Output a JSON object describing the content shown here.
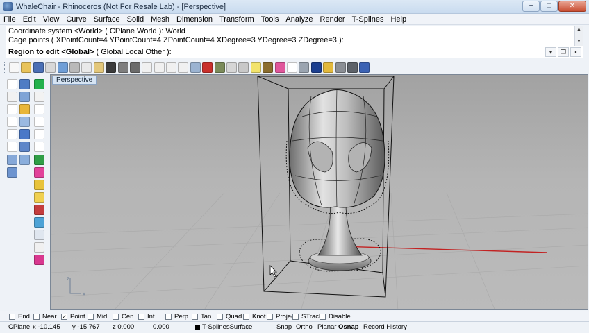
{
  "window": {
    "title": "WhaleChair - Rhinoceros (Not For Resale Lab) - [Perspective]",
    "controls": [
      "−",
      "□",
      "✕"
    ]
  },
  "menu": [
    "File",
    "Edit",
    "View",
    "Curve",
    "Surface",
    "Solid",
    "Mesh",
    "Dimension",
    "Transform",
    "Tools",
    "Analyze",
    "Render",
    "T-Splines",
    "Help"
  ],
  "command": {
    "history": [
      "Coordinate system <World> ( CPlane  World ): World",
      "Cage points ( XPointCount=4  YPointCount=4  ZPointCount=4  XDegree=3  YDegree=3  ZDegree=3 ):"
    ],
    "prompt_bold": "Region to edit <Global>",
    "prompt_rest": " ( Global  Local  Other ):",
    "input_value": ""
  },
  "toolbar": {
    "icons": [
      "new-file-icon",
      "open-folder-icon",
      "save-icon",
      "print-icon",
      "import-icon",
      "cut-icon",
      "copy-icon",
      "paste-icon",
      "undo-icon",
      "pan-icon",
      "rotate-view-icon",
      "zoom-icon",
      "zoom-window-icon",
      "zoom-extents-icon",
      "zoom-selected-icon",
      "four-viewports-icon",
      "car-icon",
      "tank-icon",
      "grid-snap-icon",
      "options-icon",
      "light-bulb-icon",
      "lock-icon",
      "color-wheel-icon",
      "wireframe-sphere-icon",
      "shaded-sphere-icon",
      "render-sphere-icon",
      "wand-icon",
      "gear-icon",
      "gears-icon",
      "help-icon"
    ],
    "colors": [
      "#f7f7f7",
      "#e8c35a",
      "#4a6fb5",
      "#d8d8d8",
      "#6f9ed6",
      "#b9b9b9",
      "#e9e9e9",
      "#e3c77a",
      "#3b3b3b",
      "#7e7e7e",
      "#6b6b6b",
      "#f0f0f0",
      "#f0f0f0",
      "#f0f0f0",
      "#f0f0f0",
      "#9bb3d1",
      "#c9302c",
      "#7b8b5a",
      "#d6d6d6",
      "#c8c8c8",
      "#f2e36b",
      "#8a6d2e",
      "#e0569b",
      "#ffffff",
      "#9aa4b0",
      "#1c3f8f",
      "#e3b93c",
      "#8b8f95",
      "#5d6269",
      "#3b62b4"
    ]
  },
  "left_toolbar": {
    "col1": [
      "select-arrow-icon",
      "point-icon",
      "circle-icon",
      "arc-icon",
      "rectangle-icon",
      "surface-icon",
      "box-icon",
      "extrude-icon",
      "loft-icon",
      "mesh-icon",
      "fillet-icon",
      "trim-icon",
      "text-icon",
      "dimension-icon",
      "block-icon"
    ],
    "col1_colors": [
      "#ffffff",
      "#f2f2f2",
      "#ffffff",
      "#ffffff",
      "#ffffff",
      "#ffffff",
      "#86a8d8",
      "#6d94cf",
      "#4f7cc4",
      "#7fa4d6",
      "#e8b63a",
      "#9ab9e2",
      "#4a78c8",
      "#5e86c9",
      "#8aaedc"
    ],
    "col2": [
      "green-circle-icon",
      "point-cloud-icon",
      "polygon-icon",
      "polyline-icon",
      "ellipse-icon",
      "helix-icon",
      "sphere-icon",
      "cylinder-icon",
      "cone-icon",
      "torus-icon",
      "boolean-icon",
      "split-icon",
      "explode-icon",
      "history-icon",
      "analyze-icon"
    ],
    "col2_colors": [
      "#22b14c",
      "#f2f2f2",
      "#ffffff",
      "#ffffff",
      "#ffffff",
      "#ffffff",
      "#2f9e46",
      "#e2429a",
      "#e8c33a",
      "#f0d050",
      "#c43d3d",
      "#4ea3d6",
      "#dfe6ef",
      "#f0f0f0",
      "#d9388f"
    ]
  },
  "viewport": {
    "name": "Perspective",
    "axis_labels": {
      "x": "x",
      "z": "z"
    },
    "colors": {
      "background": "#b0b0b0",
      "xaxis": "#c22222",
      "yaxis": "#22a022",
      "cage": "#111111"
    }
  },
  "osnap": [
    {
      "label": "End",
      "checked": false
    },
    {
      "label": "Near",
      "checked": false
    },
    {
      "label": "Point",
      "checked": true
    },
    {
      "label": "Mid",
      "checked": false
    },
    {
      "label": "Cen",
      "checked": false
    },
    {
      "label": "Int",
      "checked": false
    },
    {
      "label": "Perp",
      "checked": false
    },
    {
      "label": "Tan",
      "checked": false
    },
    {
      "label": "Quad",
      "checked": false
    },
    {
      "label": "Knot",
      "checked": false
    },
    {
      "label": "Project",
      "checked": false
    },
    {
      "label": "STrack",
      "checked": false
    },
    {
      "label": "Disable",
      "checked": false
    }
  ],
  "status": {
    "cplane": "CPlane",
    "x": "x -10.145",
    "y": "y -15.767",
    "z": "z 0.000",
    "extra": "0.000",
    "layer": "T-SplinesSurface",
    "snap": "Snap",
    "ortho": "Ortho",
    "planar": "Planar",
    "osnap": "Osnap",
    "record": "Record History"
  }
}
